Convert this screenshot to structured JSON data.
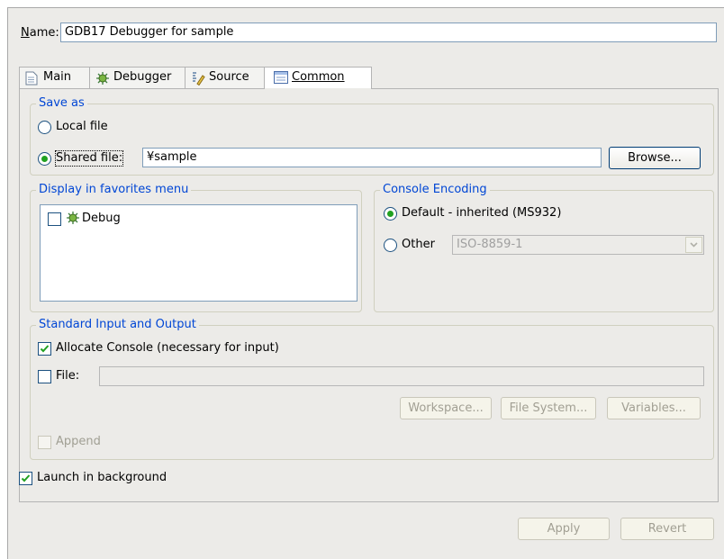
{
  "name_row": {
    "label": "Name:",
    "value": "GDB17 Debugger for sample"
  },
  "tabs": [
    {
      "label": "Main",
      "icon": "document-icon"
    },
    {
      "label": "Debugger",
      "icon": "bug-icon"
    },
    {
      "label": "Source",
      "icon": "source-icon"
    },
    {
      "label": "Common",
      "icon": "common-icon",
      "active": true
    }
  ],
  "save_as": {
    "title": "Save as",
    "local_label": "Local file",
    "shared_label": "Shared file:",
    "shared_value": "¥sample",
    "selected": "shared",
    "browse_label": "Browse..."
  },
  "favorites": {
    "title": "Display in favorites menu",
    "items": [
      {
        "label": "Debug",
        "checked": false,
        "icon": "bug-icon"
      }
    ]
  },
  "console_encoding": {
    "title": "Console Encoding",
    "default_label": "Default - inherited (MS932)",
    "other_label": "Other",
    "other_value": "ISO-8859-1",
    "selected": "default"
  },
  "std_io": {
    "title": "Standard Input and Output",
    "allocate_label": "Allocate Console (necessary for input)",
    "allocate_checked": true,
    "file_label": "File:",
    "file_checked": false,
    "file_value": "",
    "workspace_label": "Workspace...",
    "filesystem_label": "File System...",
    "variables_label": "Variables...",
    "append_label": "Append",
    "append_checked": false
  },
  "launch_background": {
    "label": "Launch in background",
    "checked": true
  },
  "footer": {
    "apply_label": "Apply",
    "revert_label": "Revert"
  },
  "colors": {
    "group_title": "#0046d5",
    "radio_dot": "#21a121",
    "panel_bg": "#ecebe8"
  }
}
